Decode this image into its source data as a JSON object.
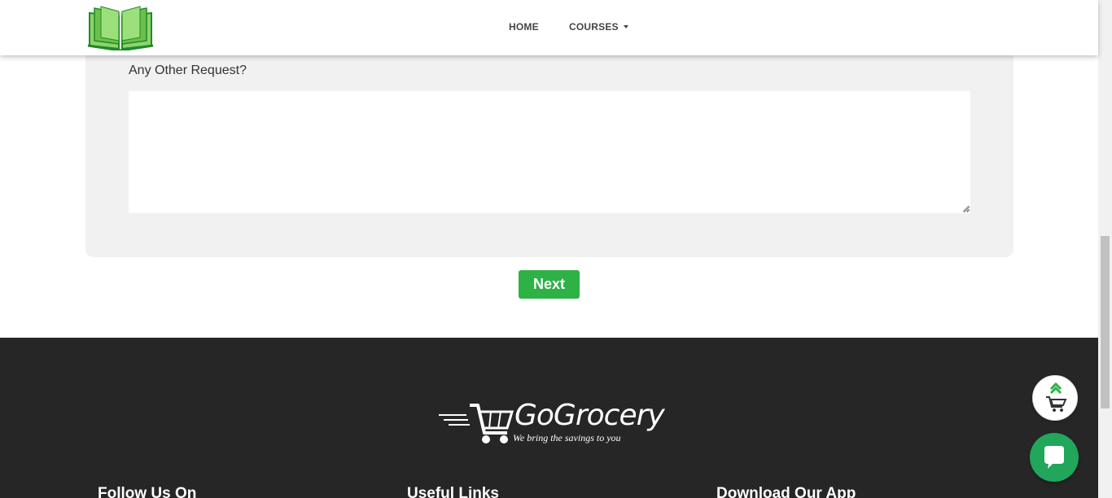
{
  "header": {
    "logo_icon": "open-book-icon",
    "nav": {
      "home_label": "HOME",
      "courses_label": "COURSES"
    }
  },
  "form": {
    "other_request_label": "Any Other Request?",
    "other_request_value": "",
    "next_label": "Next"
  },
  "footer": {
    "brand_name": "GoGrocery",
    "brand_tagline": "We bring the savings to you",
    "headings": {
      "follow": "Follow Us On",
      "links": "Useful Links",
      "app": "Download Our App"
    }
  },
  "floating": {
    "cart_icon": "scroll-top-cart-icon",
    "chat_icon": "chat-bubble-icon"
  },
  "colors": {
    "accent_green": "#2eb145",
    "chat_green": "#21a65b",
    "footer_bg": "#262626",
    "card_bg": "#f0f1f0"
  }
}
